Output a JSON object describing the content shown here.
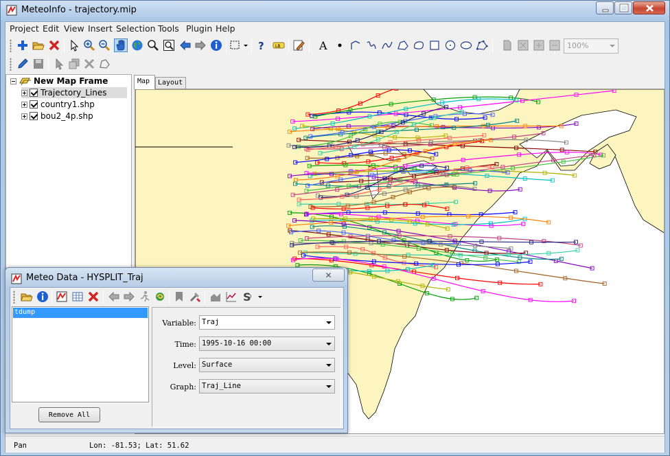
{
  "window": {
    "title": "MeteoInfo - trajectory.mip"
  },
  "menu": [
    "Project",
    "Edit",
    "View",
    "Insert",
    "Selection",
    "Tools",
    "Plugin",
    "Help"
  ],
  "toolbar": {
    "zoom_value": "100%"
  },
  "layers": {
    "frame": "New Map Frame",
    "items": [
      "Trajectory_Lines",
      "country1.shp",
      "bou2_4p.shp"
    ]
  },
  "tabs": [
    "Map",
    "Layout"
  ],
  "status": {
    "mode": "Pan",
    "coords": "Lon: -81.53; Lat: 51.62"
  },
  "colors": {
    "land": "#fdf5c0",
    "selection": "#3399ff",
    "boundary": "#000000"
  },
  "dialog": {
    "title": "Meteo Data - HYSPLIT_Traj",
    "files": [
      "tdump"
    ],
    "remove_all": "Remove All",
    "fields": [
      {
        "label": "Variable:",
        "value": "Traj"
      },
      {
        "label": "Time:",
        "value": "1995-10-16 00:00"
      },
      {
        "label": "Level:",
        "value": "Surface"
      },
      {
        "label": "Graph:",
        "value": "Traj_Line"
      }
    ]
  }
}
